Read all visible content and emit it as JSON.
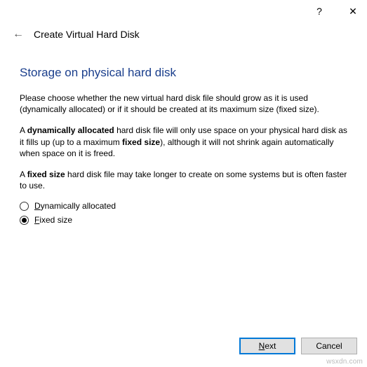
{
  "titlebar": {
    "help_symbol": "?",
    "close_symbol": "✕"
  },
  "header": {
    "back_symbol": "←",
    "title": "Create Virtual Hard Disk"
  },
  "section": {
    "title": "Storage on physical hard disk",
    "para1": "Please choose whether the new virtual hard disk file should grow as it is used (dynamically allocated) or if it should be created at its maximum size (fixed size).",
    "para2_a": "A ",
    "para2_b": "dynamically allocated",
    "para2_c": " hard disk file will only use space on your physical hard disk as it fills up (up to a maximum ",
    "para2_d": "fixed size",
    "para2_e": "), although it will not shrink again automatically when space on it is freed.",
    "para3_a": "A ",
    "para3_b": "fixed size",
    "para3_c": " hard disk file may take longer to create on some systems but is often faster to use."
  },
  "options": {
    "dyn_u": "D",
    "dyn_rest": "ynamically allocated",
    "fix_u": "F",
    "fix_rest": "ixed size",
    "selected": "fixed"
  },
  "footer": {
    "next_u": "N",
    "next_rest": "ext",
    "cancel": "Cancel"
  },
  "watermark": "wsxdn.com"
}
